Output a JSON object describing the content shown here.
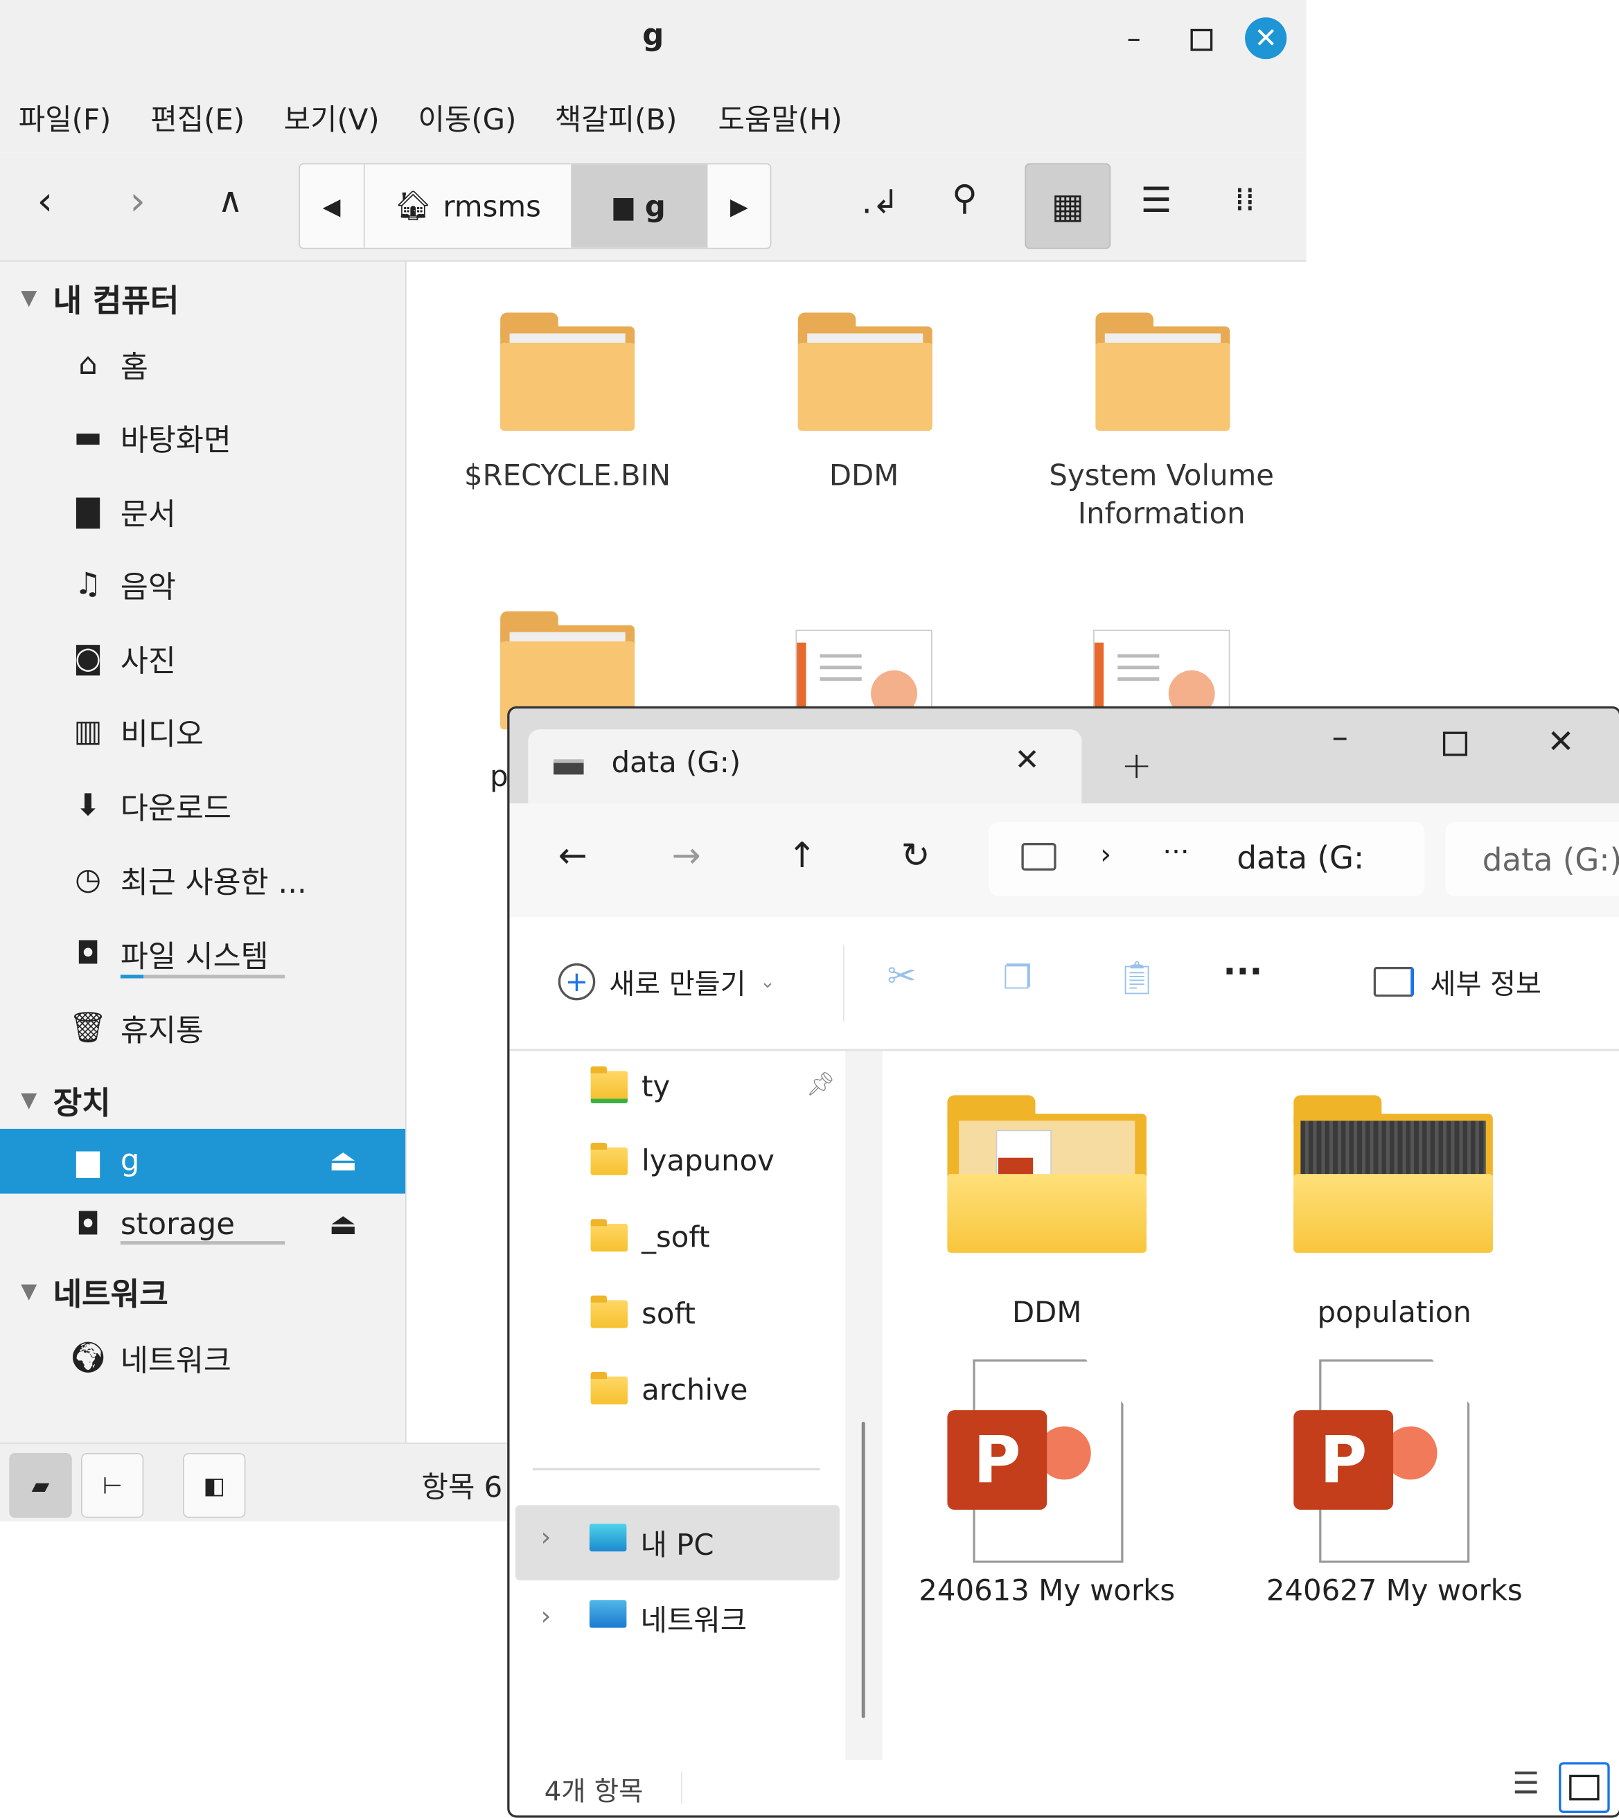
{
  "linux_window": {
    "title": "g",
    "menu": [
      "파일(F)",
      "편집(E)",
      "보기(V)",
      "이동(G)",
      "책갈피(B)",
      "도움말(H)"
    ],
    "path": [
      {
        "label": "rmsms",
        "icon": "home-icon"
      },
      {
        "label": "g",
        "icon": "drive-icon",
        "selected": true
      }
    ],
    "view_mode": "icon-view",
    "sidebar": {
      "sections": [
        {
          "label": "내 컴퓨터",
          "items": [
            {
              "label": "홈",
              "icon": "home-icon"
            },
            {
              "label": "바탕화면",
              "icon": "desktop-icon"
            },
            {
              "label": "문서",
              "icon": "document-icon"
            },
            {
              "label": "음악",
              "icon": "music-icon"
            },
            {
              "label": "사진",
              "icon": "camera-icon"
            },
            {
              "label": "비디오",
              "icon": "film-icon"
            },
            {
              "label": "다운로드",
              "icon": "download-icon"
            },
            {
              "label": "최근 사용한 ...",
              "icon": "clock-icon"
            },
            {
              "label": "파일 시스템",
              "icon": "harddisk-icon"
            },
            {
              "label": "휴지통",
              "icon": "trash-icon"
            }
          ]
        },
        {
          "label": "장치",
          "items": [
            {
              "label": "g",
              "icon": "drive-icon",
              "selected": true,
              "eject": true
            },
            {
              "label": "storage",
              "icon": "harddisk-icon",
              "eject": true
            }
          ]
        },
        {
          "label": "네트워크",
          "items": [
            {
              "label": "네트워크",
              "icon": "globe-icon"
            }
          ]
        }
      ]
    },
    "files": [
      {
        "name": "$RECYCLE.BIN",
        "type": "folder"
      },
      {
        "name": "DDM",
        "type": "folder"
      },
      {
        "name": "System Volume Information",
        "type": "folder"
      },
      {
        "name": "p",
        "type": "folder"
      },
      {
        "name": "",
        "type": "presentation"
      },
      {
        "name": "",
        "type": "presentation"
      }
    ],
    "status": "항목 6"
  },
  "windows_window": {
    "tab_title": "data (G:)",
    "address": {
      "crumbs": [
        "···",
        "data (G:"
      ],
      "search_placeholder": "data (G:)"
    },
    "commands": {
      "new": "새로 만들기",
      "details": "세부 정보"
    },
    "nav": [
      {
        "label": "ty",
        "pinned": true
      },
      {
        "label": "lyapunov"
      },
      {
        "label": "_soft"
      },
      {
        "label": "soft"
      },
      {
        "label": "archive"
      }
    ],
    "nav_roots": [
      {
        "label": "내 PC",
        "selected": true
      },
      {
        "label": "네트워크"
      }
    ],
    "files": [
      {
        "name": "DDM",
        "type": "folder"
      },
      {
        "name": "population",
        "type": "folder"
      },
      {
        "name": "240613 My works",
        "type": "pptx"
      },
      {
        "name": "240627 My works",
        "type": "pptx"
      }
    ],
    "status": "4개 항목"
  },
  "colors": {
    "linux_accent": "#1e95d4",
    "folder": "#f8c572",
    "ppt": "#c43e1c"
  }
}
